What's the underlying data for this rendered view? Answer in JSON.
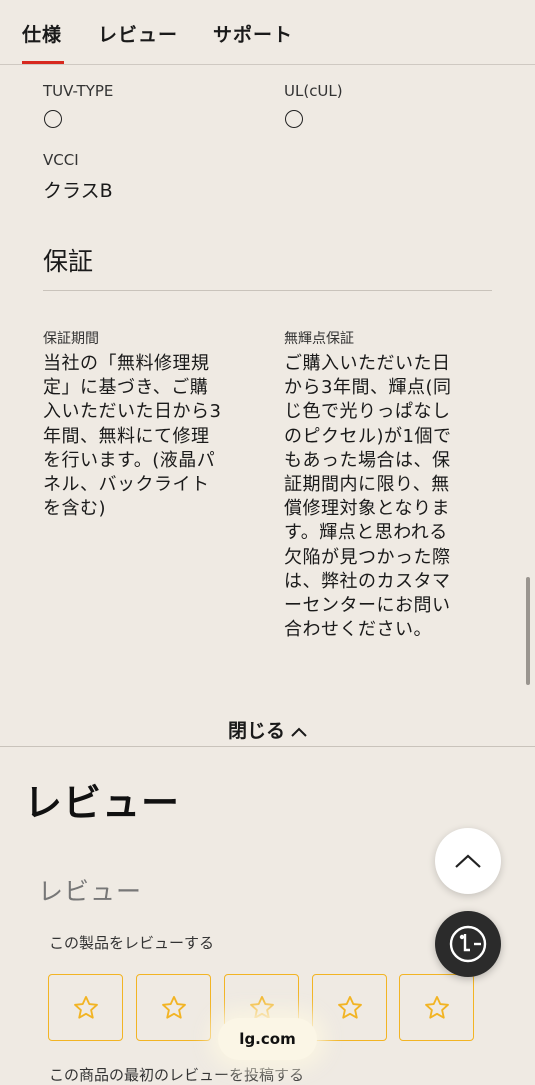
{
  "tabs": [
    {
      "label": "仕様"
    },
    {
      "label": "レビュー"
    },
    {
      "label": "サポート"
    }
  ],
  "colors": {
    "accent": "#d7281e",
    "star": "#f2b424",
    "background": "#efeae3"
  },
  "specs": {
    "tuv_label": "TUV-TYPE",
    "ul_label": "UL(cUL)",
    "vcci_label": "VCCI",
    "vcci_value": "クラスB",
    "circle_icon": "circle-mark-icon"
  },
  "warranty": {
    "title": "保証",
    "period_label": "保証期間",
    "period_lines": [
      "当社の「無料修理規",
      "定」に基づき、ご購",
      "入いただいた日から3",
      "年間、無料にて修理",
      "を行います。(液晶パ",
      "ネル、バックライト",
      "を含む)"
    ],
    "bright_label": "無輝点保証",
    "bright_lines": [
      "ご購入いただいた日",
      "から3年間、輝点(同",
      "じ色で光りっぱなし",
      "のピクセル)が1個で",
      "もあった場合は、保",
      "証期間内に限り、無",
      "償修理対象となりま",
      "す。輝点と思われる",
      "欠陥が見つかった際",
      "は、弊社のカスタマ",
      "ーセンターにお問い",
      "合わせください。"
    ]
  },
  "close_label": "閉じる",
  "reviews": {
    "heading": "レビュー",
    "subheading": "レビュー",
    "prompt": "この製品をレビューする",
    "stars": 5,
    "bottom_text": "この商品の最初のレビューを投稿する"
  },
  "browser": {
    "url": "lg.com"
  }
}
